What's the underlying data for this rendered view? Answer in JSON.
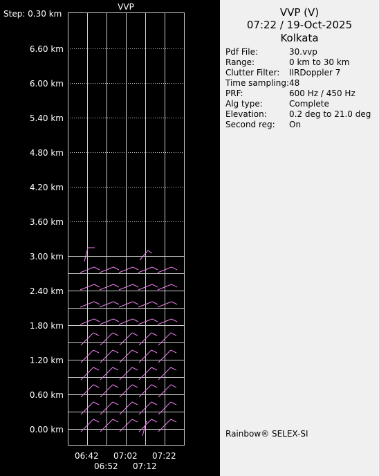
{
  "plot": {
    "title": "VVP",
    "step_label": "Step: 0.30 km",
    "y_ticks": [
      "6.60 km",
      "6.00 km",
      "5.40 km",
      "4.80 km",
      "4.20 km",
      "3.60 km",
      "3.00 km",
      "2.40 km",
      "1.80 km",
      "1.20 km",
      "0.60 km",
      "0.00 km"
    ],
    "x_ticks_top": [
      "06:42",
      "07:02",
      "07:22"
    ],
    "x_ticks_bottom": [
      "06:52",
      "07:12"
    ],
    "barb_color": "#ee82ee"
  },
  "info": {
    "title": "VVP (V)",
    "datetime": "07:22 / 19-Oct-2025",
    "site": "Kolkata",
    "rows": [
      {
        "label": "Pdf File:",
        "value": "30.vvp"
      },
      {
        "label": "Range:",
        "value": "0 km to 30 km"
      },
      {
        "label": "Clutter Filter:",
        "value": "IIRDoppler 7"
      },
      {
        "label": "Time sampling:",
        "value": "48"
      },
      {
        "label": "PRF:",
        "value": "600 Hz / 450 Hz"
      },
      {
        "label": "Alg type:",
        "value": "Complete"
      },
      {
        "label": "Elevation:",
        "value": "0.2 deg to 21.0 deg"
      },
      {
        "label": "Second reg:",
        "value": "On"
      }
    ],
    "brand": "Rainbow® SELEX-SI"
  }
}
